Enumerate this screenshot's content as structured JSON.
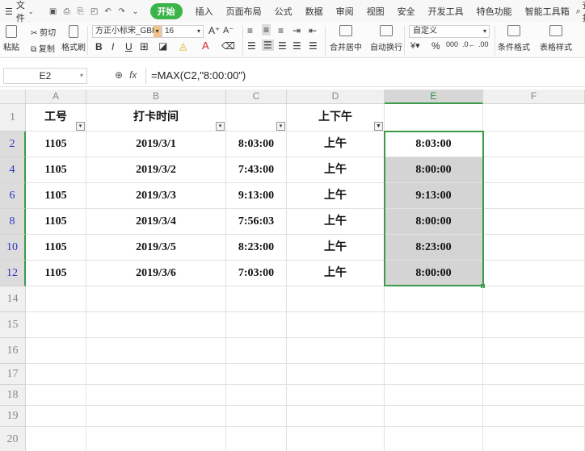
{
  "menubar": {
    "file_label": "文件",
    "tabs": [
      "开始",
      "插入",
      "页面布局",
      "公式",
      "数据",
      "审阅",
      "视图",
      "安全",
      "开发工具",
      "特色功能",
      "智能工具箱"
    ],
    "active_tab": "开始",
    "search_label": "查找"
  },
  "toolbar": {
    "paste": "粘贴",
    "cut": "剪切",
    "copy": "复制",
    "format_painter": "格式刷",
    "font_name": "方正小标宋_GBK",
    "font_size": "16",
    "merge_center": "合并居中",
    "wrap_text": "自动换行",
    "number_format": "自定义",
    "conditional_format": "条件格式",
    "table_style": "表格样式"
  },
  "formula_bar": {
    "name_box": "E2",
    "fx": "fx",
    "formula": "=MAX(C2,\"8:00:00\")"
  },
  "sheet": {
    "columns": [
      "A",
      "B",
      "C",
      "D",
      "E",
      "F"
    ],
    "selected_column": "E",
    "header_row": {
      "row": "1",
      "A": "工号",
      "B": "打卡时间",
      "C": "",
      "D": "上下午",
      "E": ""
    },
    "rows": [
      {
        "row": "2",
        "A": "1105",
        "B": "2019/3/1",
        "C": "8:03:00",
        "D": "上午",
        "E": "8:03:00"
      },
      {
        "row": "4",
        "A": "1105",
        "B": "2019/3/2",
        "C": "7:43:00",
        "D": "上午",
        "E": "8:00:00"
      },
      {
        "row": "6",
        "A": "1105",
        "B": "2019/3/3",
        "C": "9:13:00",
        "D": "上午",
        "E": "9:13:00"
      },
      {
        "row": "8",
        "A": "1105",
        "B": "2019/3/4",
        "C": "7:56:03",
        "D": "上午",
        "E": "8:00:00"
      },
      {
        "row": "10",
        "A": "1105",
        "B": "2019/3/5",
        "C": "8:23:00",
        "D": "上午",
        "E": "8:23:00"
      },
      {
        "row": "12",
        "A": "1105",
        "B": "2019/3/6",
        "C": "7:03:00",
        "D": "上午",
        "E": "8:00:00"
      }
    ],
    "empty_rows": [
      "14",
      "15",
      "16",
      "17",
      "18",
      "19",
      "20"
    ]
  }
}
